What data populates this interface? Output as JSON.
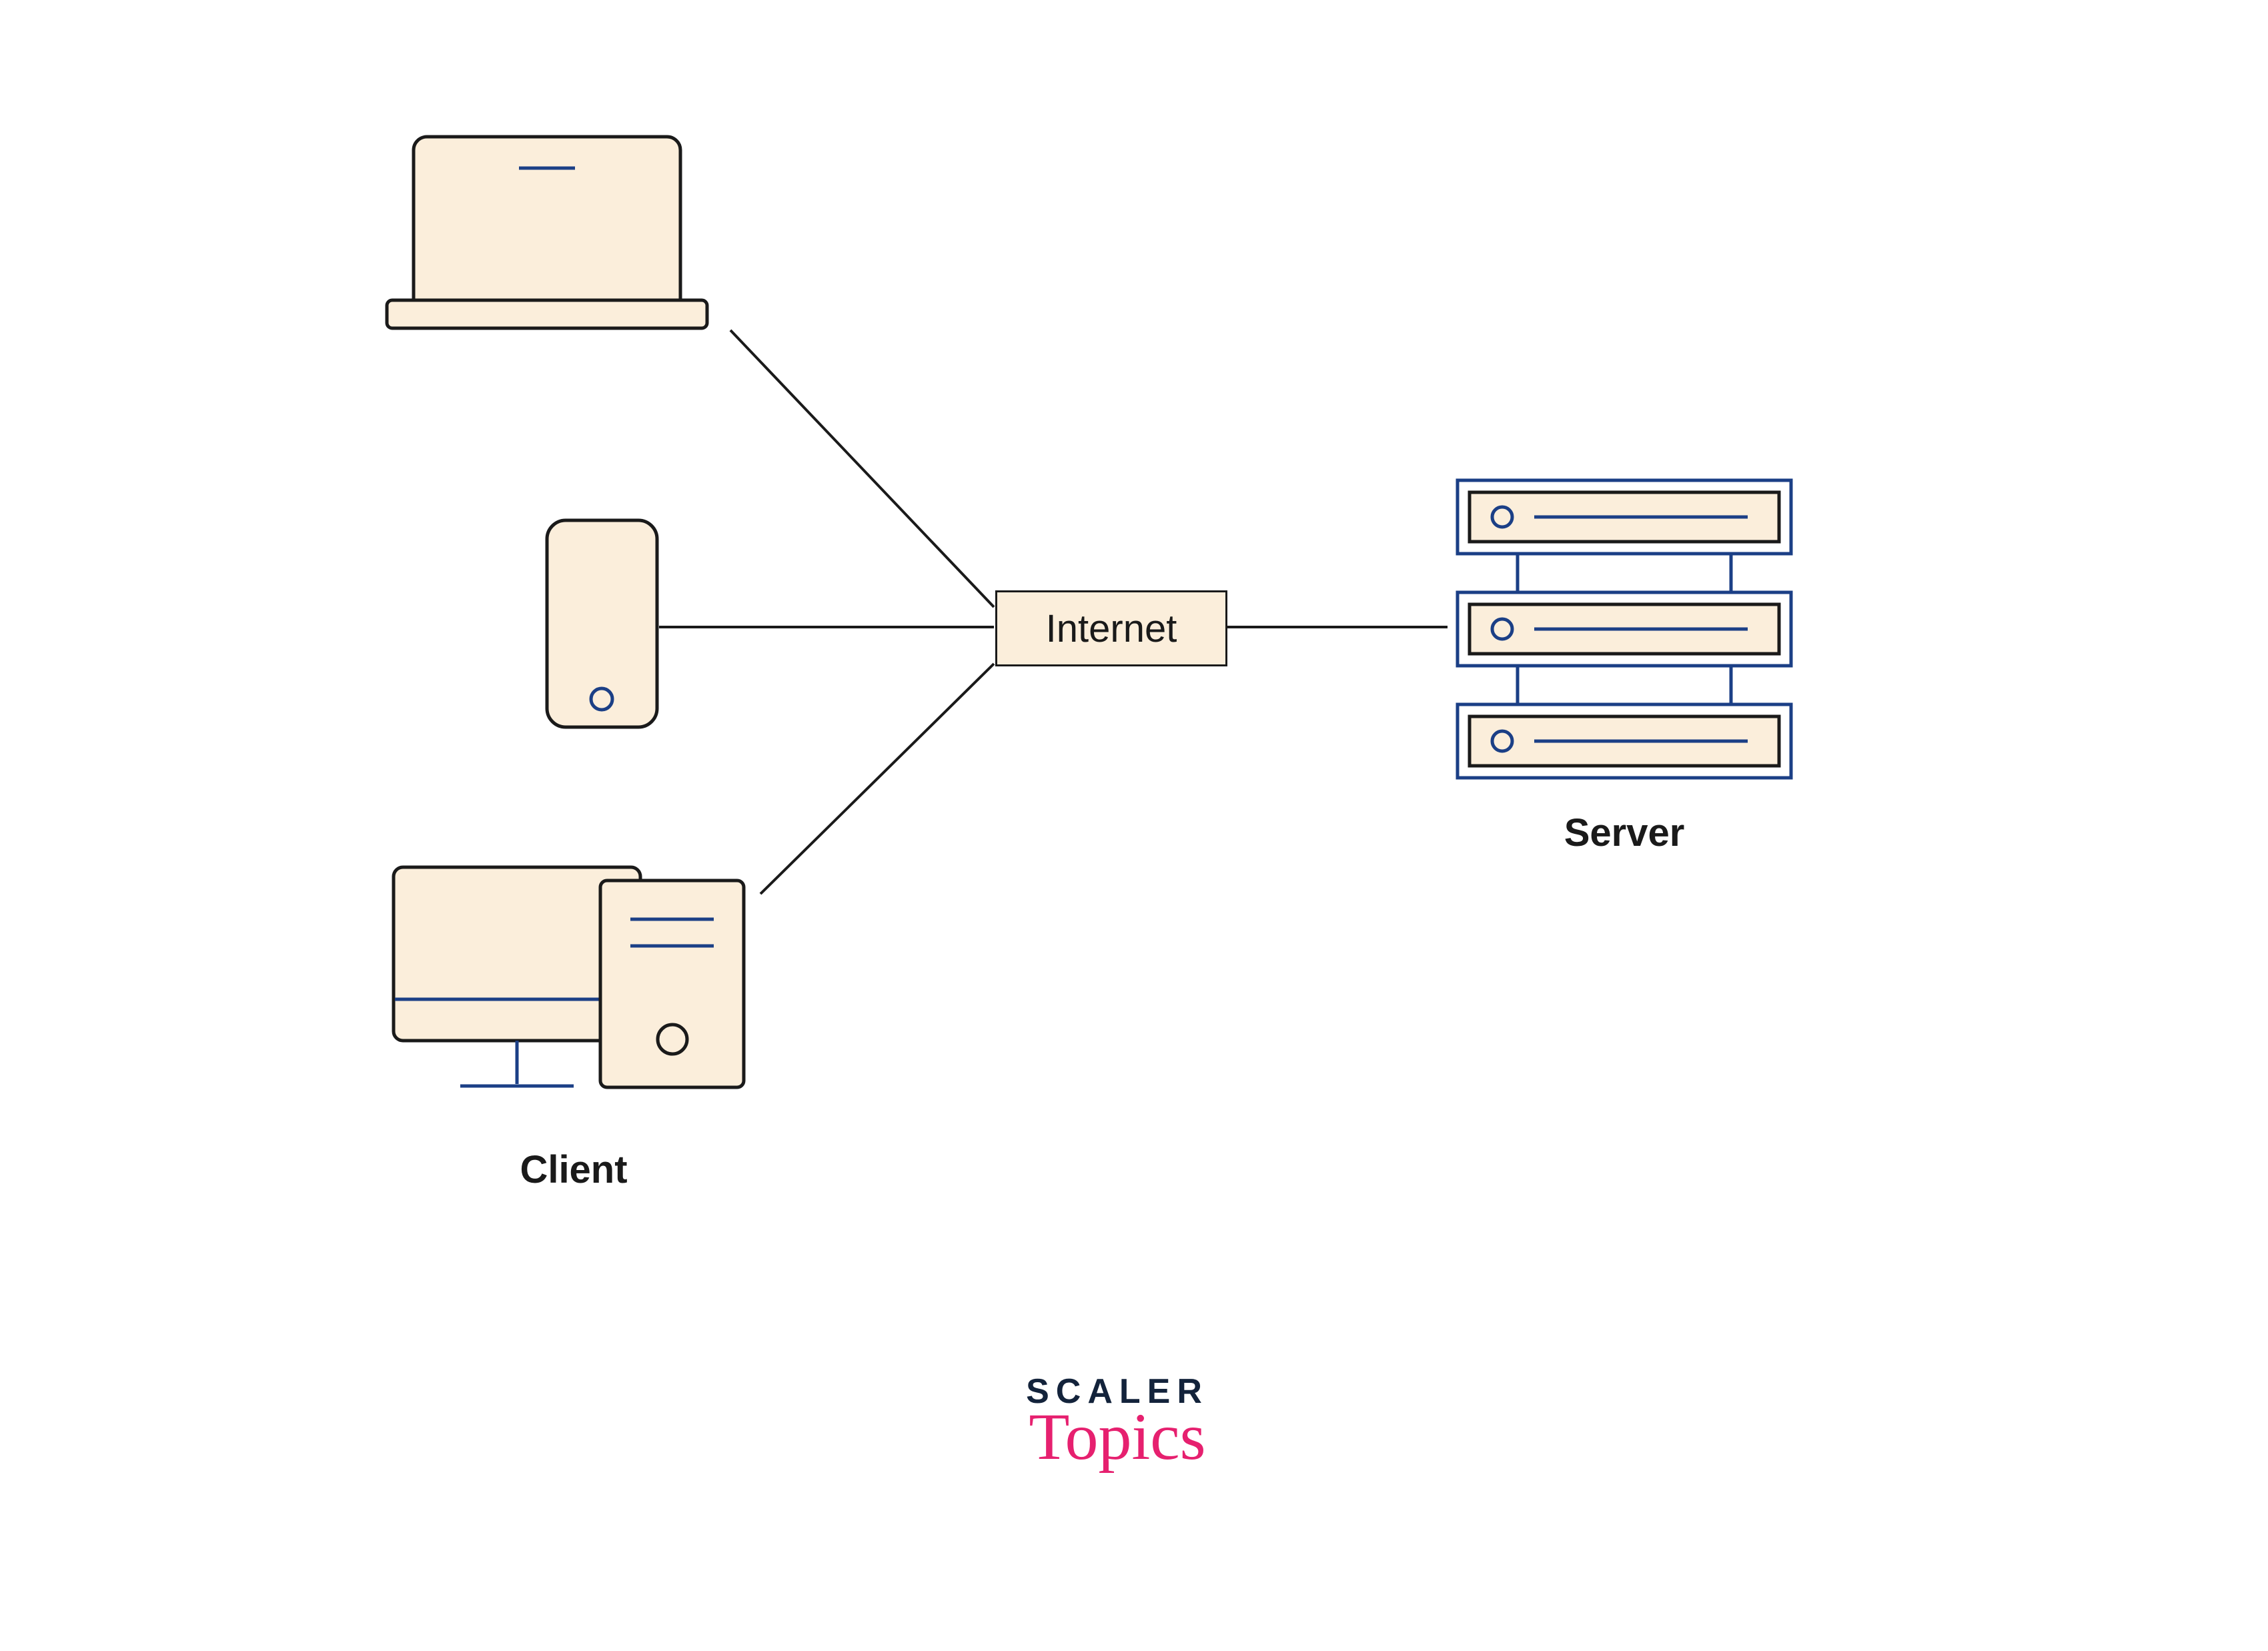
{
  "nodes": {
    "internet_label": "Internet",
    "client_label": "Client",
    "server_label": "Server"
  },
  "logo": {
    "line1": "SCALER",
    "line2": "Topics"
  },
  "colors": {
    "fill": "#fbeedb",
    "stroke_dark": "#1a1a1a",
    "stroke_blue": "#1b3f86",
    "logo_dark": "#13233b",
    "logo_pink": "#e6206f"
  }
}
